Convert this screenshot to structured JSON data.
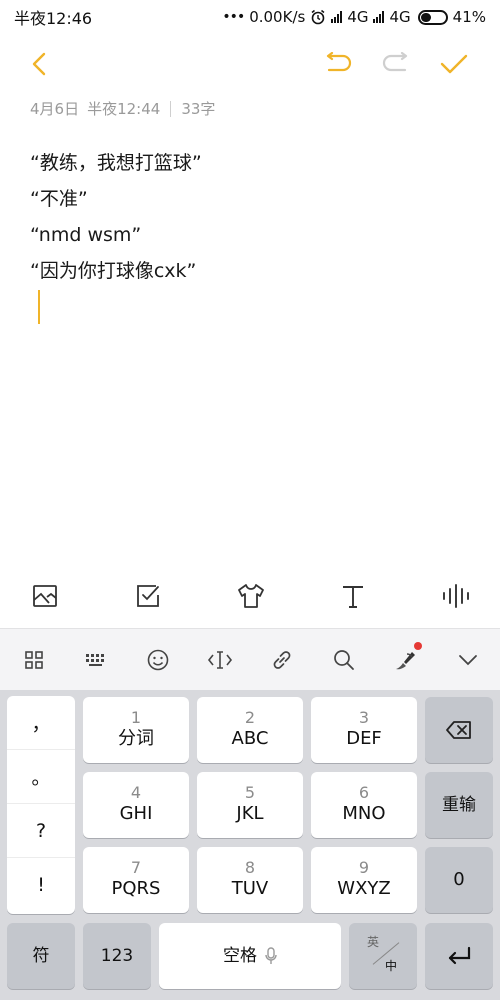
{
  "status_bar": {
    "time": "半夜12:46",
    "network_speed": "0.00K/s",
    "net1": "4G",
    "net2": "4G",
    "battery": "41%"
  },
  "toolbar": {
    "back_icon": "chevron-left-icon",
    "undo_icon": "undo-icon",
    "redo_icon": "redo-icon",
    "done_icon": "check-icon",
    "accent_color": "#f0b429"
  },
  "note": {
    "date": "4月6日",
    "time": "半夜12:44",
    "char_count": "33字",
    "lines": [
      "“教练，我想打篮球”",
      "“不准”",
      "“nmd wsm”",
      "“因为你打球像cxk”"
    ]
  },
  "edit_toolbar": {
    "items": [
      "image-icon",
      "checklist-icon",
      "theme-icon",
      "text-format-icon",
      "voice-icon"
    ]
  },
  "keyboard": {
    "top_bar": [
      "grid-icon",
      "keyboard-icon",
      "emoji-icon",
      "cursor-icon",
      "link-icon",
      "search-icon",
      "skin-icon",
      "collapse-icon"
    ],
    "punctuation": [
      "，",
      "。",
      "?",
      "!"
    ],
    "keys": [
      {
        "num": "1",
        "label": "分词"
      },
      {
        "num": "2",
        "label": "ABC"
      },
      {
        "num": "3",
        "label": "DEF"
      },
      {
        "num": "4",
        "label": "GHI"
      },
      {
        "num": "5",
        "label": "JKL"
      },
      {
        "num": "6",
        "label": "MNO"
      },
      {
        "num": "7",
        "label": "PQRS"
      },
      {
        "num": "8",
        "label": "TUV"
      },
      {
        "num": "9",
        "label": "WXYZ"
      }
    ],
    "reenter": "重输",
    "zero": "0",
    "symbol": "符",
    "numeric": "123",
    "space": "空格",
    "lang_en": "英",
    "lang_zh": "中"
  }
}
